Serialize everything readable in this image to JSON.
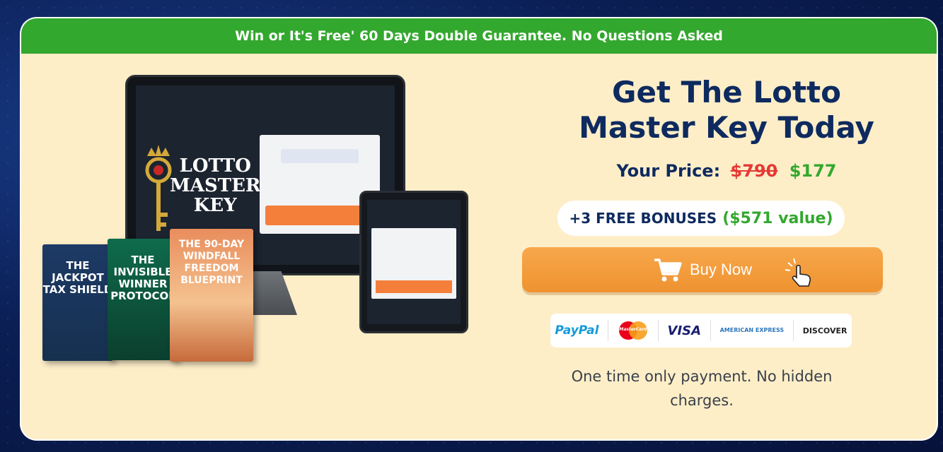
{
  "banner": {
    "text": "Win or It's Free' 60 Days Double Guarantee. No Questions Asked"
  },
  "product": {
    "headline_line1": "Get The Lotto",
    "headline_line2": "Master Key Today",
    "price_label": "Your Price:",
    "old_price": "$790",
    "new_price": "$177"
  },
  "mockup": {
    "logo_lines": [
      "LOTTO",
      "MASTER",
      "KEY"
    ],
    "books": [
      {
        "title": "THE JACKPOT TAX SHIELD"
      },
      {
        "title": "THE INVISIBLE WINNER PROTOCOL"
      },
      {
        "title": "THE 90-DAY WINDFALL FREEDOM BLUEPRINT"
      }
    ]
  },
  "bonus": {
    "label": "+3 FREE BONUSES",
    "value": "($571 value)"
  },
  "buy_button": {
    "label": "Buy Now",
    "icon": "shopping-cart-icon"
  },
  "payments": [
    {
      "name": "PayPal"
    },
    {
      "name": "MasterCard"
    },
    {
      "name": "VISA"
    },
    {
      "name": "AMERICAN EXPRESS"
    },
    {
      "name": "DISCOVER"
    }
  ],
  "footnote": "One time only payment. No hidden charges.",
  "colors": {
    "banner_green": "#33a82e",
    "card_bg": "#fdeec8",
    "headline_navy": "#0e2a5f",
    "old_price_red": "#e53935",
    "button_orange": "#ef9230"
  }
}
